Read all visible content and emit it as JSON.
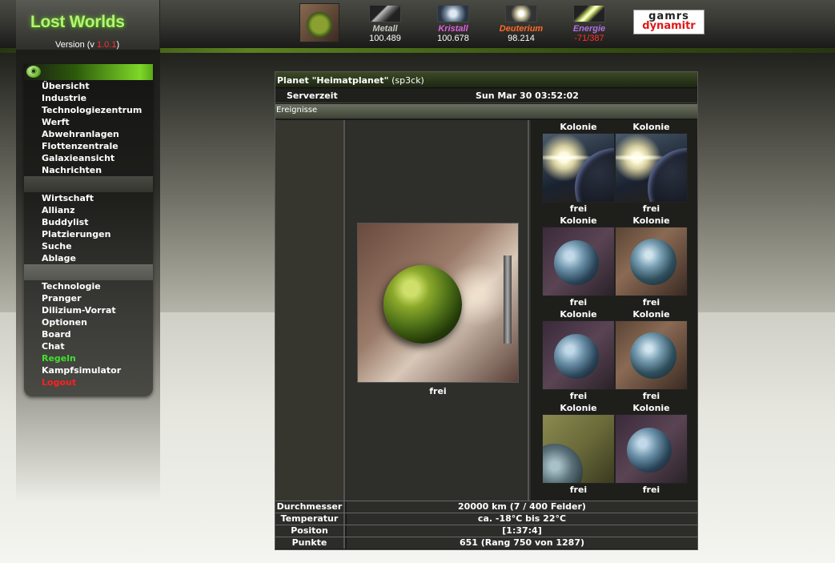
{
  "logo": {
    "title": "Lost Worlds",
    "version_prefix": "Version (v ",
    "version_number": "1.0.1",
    "version_suffix": ")"
  },
  "resources": [
    {
      "name": "Metall",
      "value": "100.489",
      "icon": "metal-icon",
      "color": "#c8c8c8"
    },
    {
      "name": "Kristall",
      "value": "100.678",
      "icon": "crystal-icon",
      "color": "#e060e0"
    },
    {
      "name": "Deuterium",
      "value": "98.214",
      "icon": "deuterium-icon",
      "color": "#ff6a2a"
    },
    {
      "name": "Energie",
      "value": "-71/387",
      "icon": "energy-icon",
      "color": "#b070e0",
      "value_color": "#ff3030"
    }
  ],
  "sponsor": {
    "line1": "gamrs",
    "line2": "dynamitr"
  },
  "nav": {
    "group1": [
      "Übersicht",
      "Industrie",
      "Technologiezentrum",
      "Werft",
      "Abwehranlagen",
      "Flottenzentrale",
      "Galaxieansicht",
      "Nachrichten"
    ],
    "group2": [
      "Wirtschaft",
      "Allianz",
      "Buddylist",
      "Platzierungen",
      "Suche",
      "Ablage"
    ],
    "group3": [
      "Technologie",
      "Pranger",
      "Dilizium-Vorrat",
      "Optionen",
      "Board",
      "Chat",
      "Regeln",
      "Kampfsimulator",
      "Logout"
    ]
  },
  "main": {
    "title": "Planet \"Heimatplanet\"",
    "owner": "(sp3ck)",
    "server_label": "Serverzeit",
    "server_time": "Sun Mar 30 03:52:02",
    "events_label": "Ereignisse",
    "home_planet_status": "frei",
    "colonies": [
      {
        "title": "Kolonie",
        "status": "frei"
      },
      {
        "title": "Kolonie",
        "status": "frei"
      },
      {
        "title": "Kolonie",
        "status": "frei"
      },
      {
        "title": "Kolonie",
        "status": "frei"
      },
      {
        "title": "Kolonie",
        "status": "frei"
      },
      {
        "title": "Kolonie",
        "status": "frei"
      },
      {
        "title": "Kolonie",
        "status": "frei"
      },
      {
        "title": "Kolonie",
        "status": "frei"
      }
    ],
    "info": [
      {
        "label": "Durchmesser",
        "value": "20000 km (7 / 400 Felder)"
      },
      {
        "label": "Temperatur",
        "value": "ca. -18°C bis 22°C"
      },
      {
        "label": "Positon",
        "value": "[1:37:4]"
      },
      {
        "label": "Punkte",
        "value": "651 (Rang 750 von 1287)"
      }
    ]
  },
  "colors": {
    "accent_green": "#7ed828",
    "logout_red": "#ff2020",
    "rules_green": "#40e030"
  }
}
